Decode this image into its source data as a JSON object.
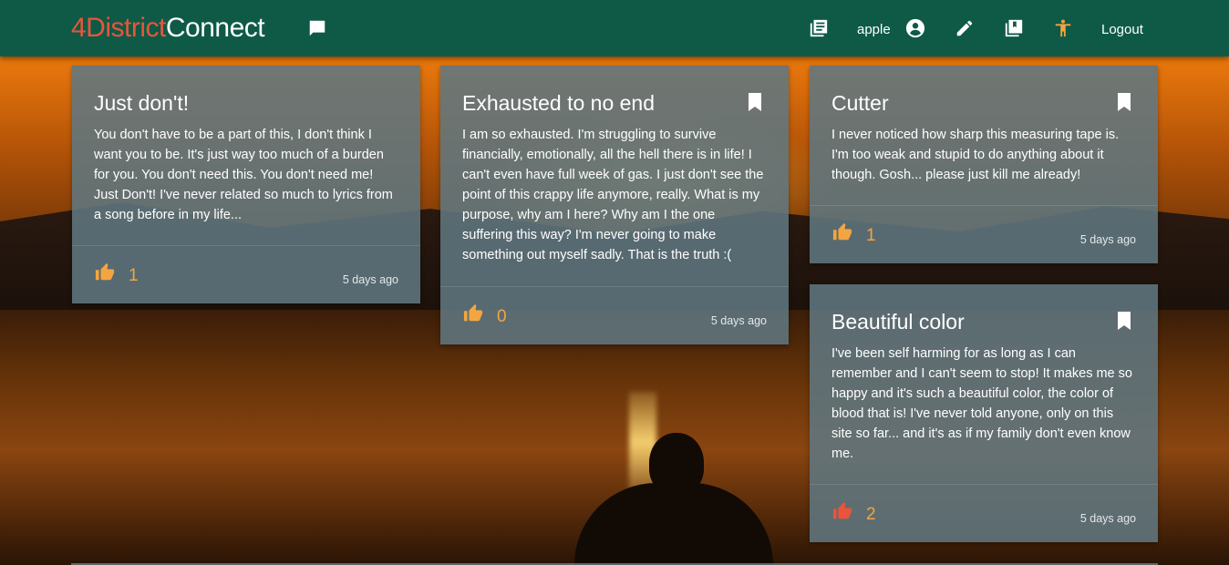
{
  "navbar": {
    "brand_part1": "4District",
    "brand_part2": "Connect",
    "username": "apple",
    "logout_label": "Logout",
    "icons": [
      "chat-icon",
      "journal-icon",
      "account-circle-icon",
      "edit-icon",
      "library-icon",
      "accessibility-icon"
    ]
  },
  "colors": {
    "navbar": "#0e5a47",
    "brand_accent": "#e8553a",
    "like_count": "#f2a540",
    "like_icon_default": "#f2a540",
    "like_icon_active": "#e8553a"
  },
  "posts": [
    {
      "title": "Just don't!",
      "body": "You don't have to be a part of this, I don't think I want you to be. It's just way too much of a burden for you. You don't need this. You don't need me! Just Don't! I've never related so much to lyrics from a song before in my life...",
      "likes": "1",
      "time": "5 days ago",
      "bookmark": false,
      "liked": false
    },
    {
      "title": "Exhausted to no end",
      "body": "I am so exhausted. I'm struggling to survive financially, emotionally, all the hell there is in life! I can't even have full week of gas. I just don't see the point of this crappy life anymore, really. What is my purpose, why am I here? Why am I the one suffering this way? I'm never going to make something out myself sadly. That is the truth :(",
      "likes": "0",
      "time": "5 days ago",
      "bookmark": true,
      "liked": false
    },
    {
      "title": "Cutter",
      "body": "I never noticed how sharp this measuring tape is. I'm too weak and stupid to do anything about it though. Gosh... please just kill me already!",
      "likes": "1",
      "time": "5 days ago",
      "bookmark": true,
      "liked": false
    },
    {
      "title": "Beautiful color",
      "body": "I've been self harming for as long as I can remember and I can't seem to stop! It makes me so happy and it's such a beautiful color, the color of blood that is! I've never told anyone, only on this site so far... and it's as if my family don't even know me.",
      "likes": "2",
      "time": "5 days ago",
      "bookmark": true,
      "liked": true
    }
  ]
}
